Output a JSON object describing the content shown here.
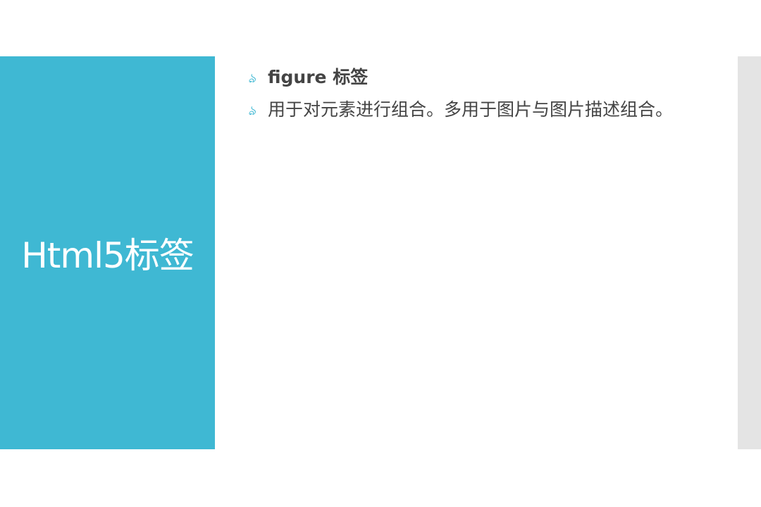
{
  "slide": {
    "side_title": "Html5标签",
    "bullets": [
      {
        "icon": "curl-bullet-icon",
        "glyph": "ঌ",
        "text": "figure 标签",
        "bold": true
      },
      {
        "icon": "curl-bullet-icon",
        "glyph": "ঌ",
        "text": "用于对元素进行组合。多用于图片与图片描述组合。",
        "bold": false
      }
    ]
  },
  "colors": {
    "accent": "#3fb8d3",
    "text": "#444444",
    "right_strip": "#e4e4e4",
    "background": "#ffffff"
  }
}
